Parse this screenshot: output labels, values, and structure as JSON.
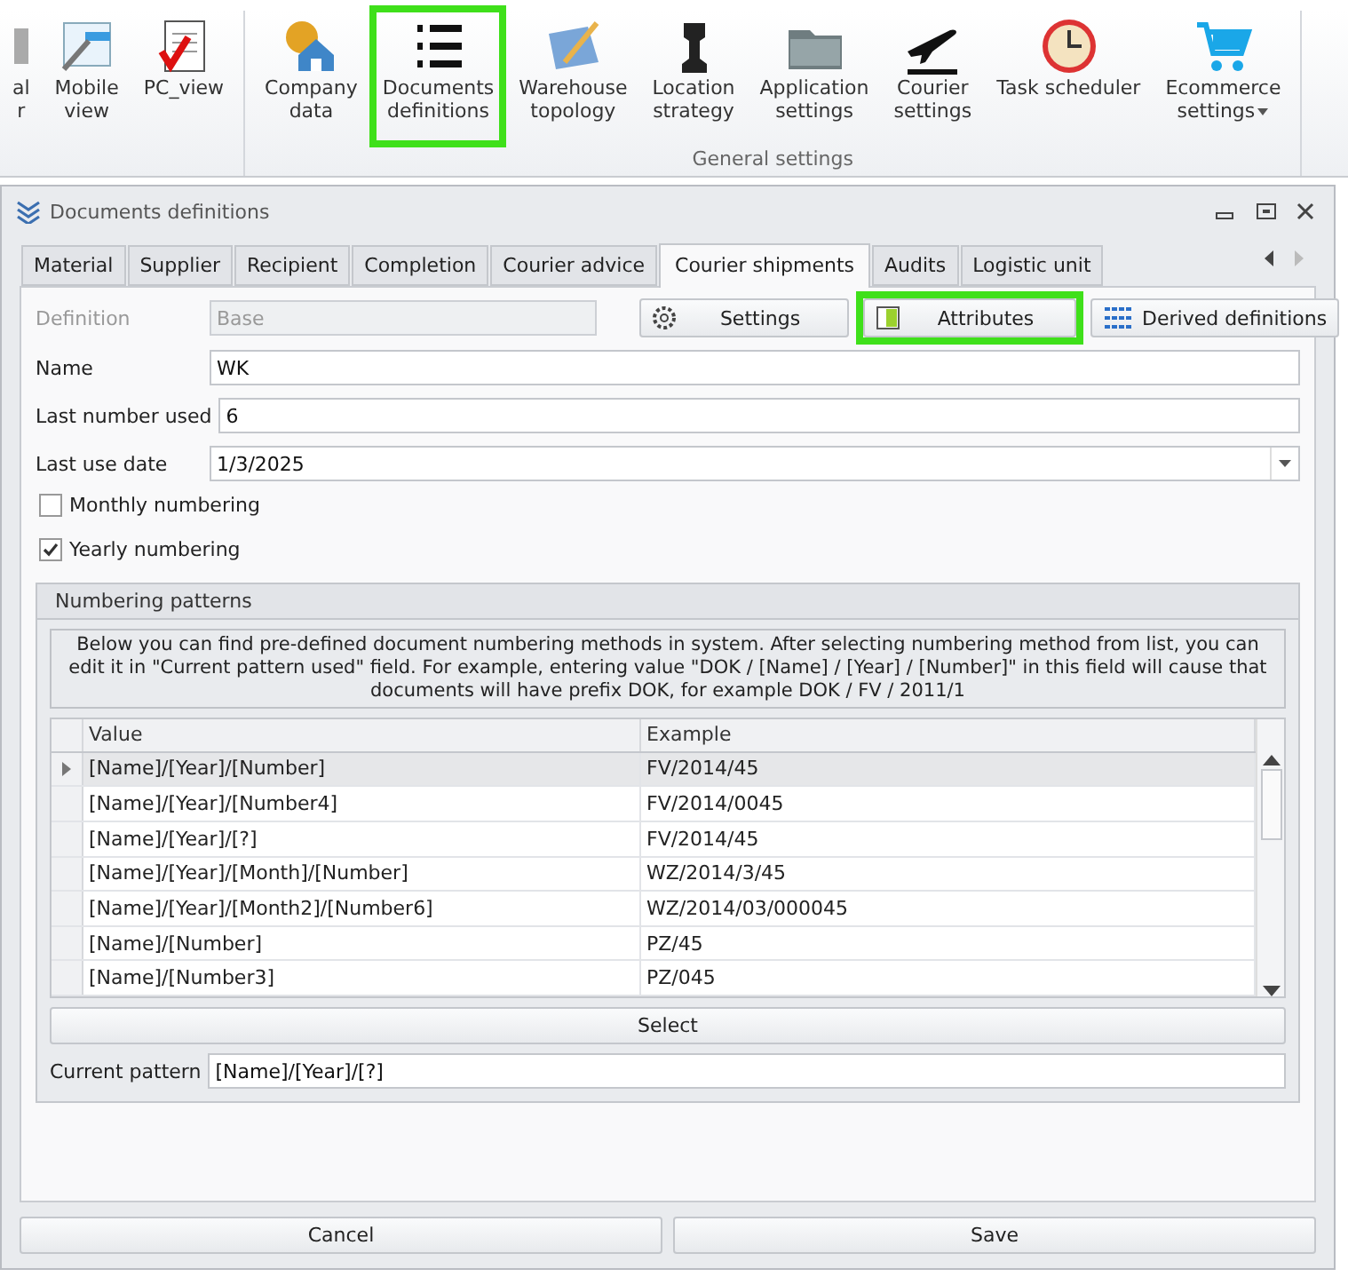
{
  "ribbon": {
    "group_label": "General settings",
    "buttons": [
      {
        "kind": "cut",
        "lines": [
          "al",
          "r"
        ],
        "highlighted": false
      },
      {
        "kind": "mobile",
        "lines": [
          "Mobile",
          "view"
        ],
        "highlighted": false
      },
      {
        "kind": "pc",
        "lines": [
          "PC_view"
        ],
        "highlighted": false
      },
      {
        "kind": "company",
        "lines": [
          "Company",
          "data"
        ],
        "highlighted": false
      },
      {
        "kind": "list",
        "lines": [
          "Documents",
          "definitions"
        ],
        "highlighted": true
      },
      {
        "kind": "topology",
        "lines": [
          "Warehouse",
          "topology"
        ],
        "highlighted": false
      },
      {
        "kind": "chess",
        "lines": [
          "Location",
          "strategy"
        ],
        "highlighted": false
      },
      {
        "kind": "folder",
        "lines": [
          "Application",
          "settings"
        ],
        "highlighted": false
      },
      {
        "kind": "plane",
        "lines": [
          "Courier",
          "settings"
        ],
        "highlighted": false
      },
      {
        "kind": "clock",
        "lines": [
          "Task scheduler"
        ],
        "highlighted": false
      },
      {
        "kind": "cart",
        "lines": [
          "Ecommerce",
          "settings"
        ],
        "highlighted": false,
        "dropdown": true
      }
    ]
  },
  "window": {
    "title": "Documents definitions"
  },
  "tabs": [
    {
      "label": "Material",
      "selected": false
    },
    {
      "label": "Supplier",
      "selected": false
    },
    {
      "label": "Recipient",
      "selected": false
    },
    {
      "label": "Completion",
      "selected": false
    },
    {
      "label": "Courier advice",
      "selected": false
    },
    {
      "label": "Courier shipments",
      "selected": true
    },
    {
      "label": "Audits",
      "selected": false
    },
    {
      "label": "Logistic unit",
      "selected": false
    }
  ],
  "definition": {
    "label": "Definition",
    "value": "Base",
    "disabled": true
  },
  "action_buttons": [
    {
      "kind": "settings",
      "label": "Settings",
      "highlighted": false
    },
    {
      "kind": "attributes",
      "label": "Attributes",
      "highlighted": true
    },
    {
      "kind": "derived",
      "label": "Derived definitions",
      "highlighted": false
    }
  ],
  "fields": [
    {
      "kind": "text",
      "label": "Name",
      "value": "WK"
    },
    {
      "kind": "text",
      "label": "Last number used",
      "value": "6"
    },
    {
      "kind": "date",
      "label": "Last use date",
      "value": "1/3/2025"
    }
  ],
  "checkboxes": [
    {
      "label": "Monthly numbering",
      "checked": false
    },
    {
      "label": "Yearly numbering",
      "checked": true
    }
  ],
  "patterns": {
    "title": "Numbering patterns",
    "info": "Below you can find pre-defined document numbering methods in system. After selecting numbering method from list, you can edit it in \"Current pattern used\" field. For example, entering value \"DOK / [Name] / [Year] / [Number]\" in this field will cause that documents  will have prefix DOK, for example DOK / FV / 2011/1",
    "columns": [
      "Value",
      "Example"
    ],
    "rows": [
      {
        "value": "[Name]/[Year]/[Number]",
        "example": "FV/2014/45",
        "selected": true
      },
      {
        "value": "[Name]/[Year]/[Number4]",
        "example": "FV/2014/0045",
        "selected": false
      },
      {
        "value": "[Name]/[Year]/[?]",
        "example": "FV/2014/45",
        "selected": false
      },
      {
        "value": "[Name]/[Year]/[Month]/[Number]",
        "example": "WZ/2014/3/45",
        "selected": false
      },
      {
        "value": "[Name]/[Year]/[Month2]/[Number6]",
        "example": "WZ/2014/03/000045",
        "selected": false
      },
      {
        "value": "[Name]/[Number]",
        "example": "PZ/45",
        "selected": false
      },
      {
        "value": "[Name]/[Number3]",
        "example": "PZ/045",
        "selected": false
      }
    ],
    "select_button": "Select",
    "current_label": "Current pattern",
    "current_value": "[Name]/[Year]/[?]"
  },
  "footer_buttons": [
    "Cancel",
    "Save"
  ]
}
